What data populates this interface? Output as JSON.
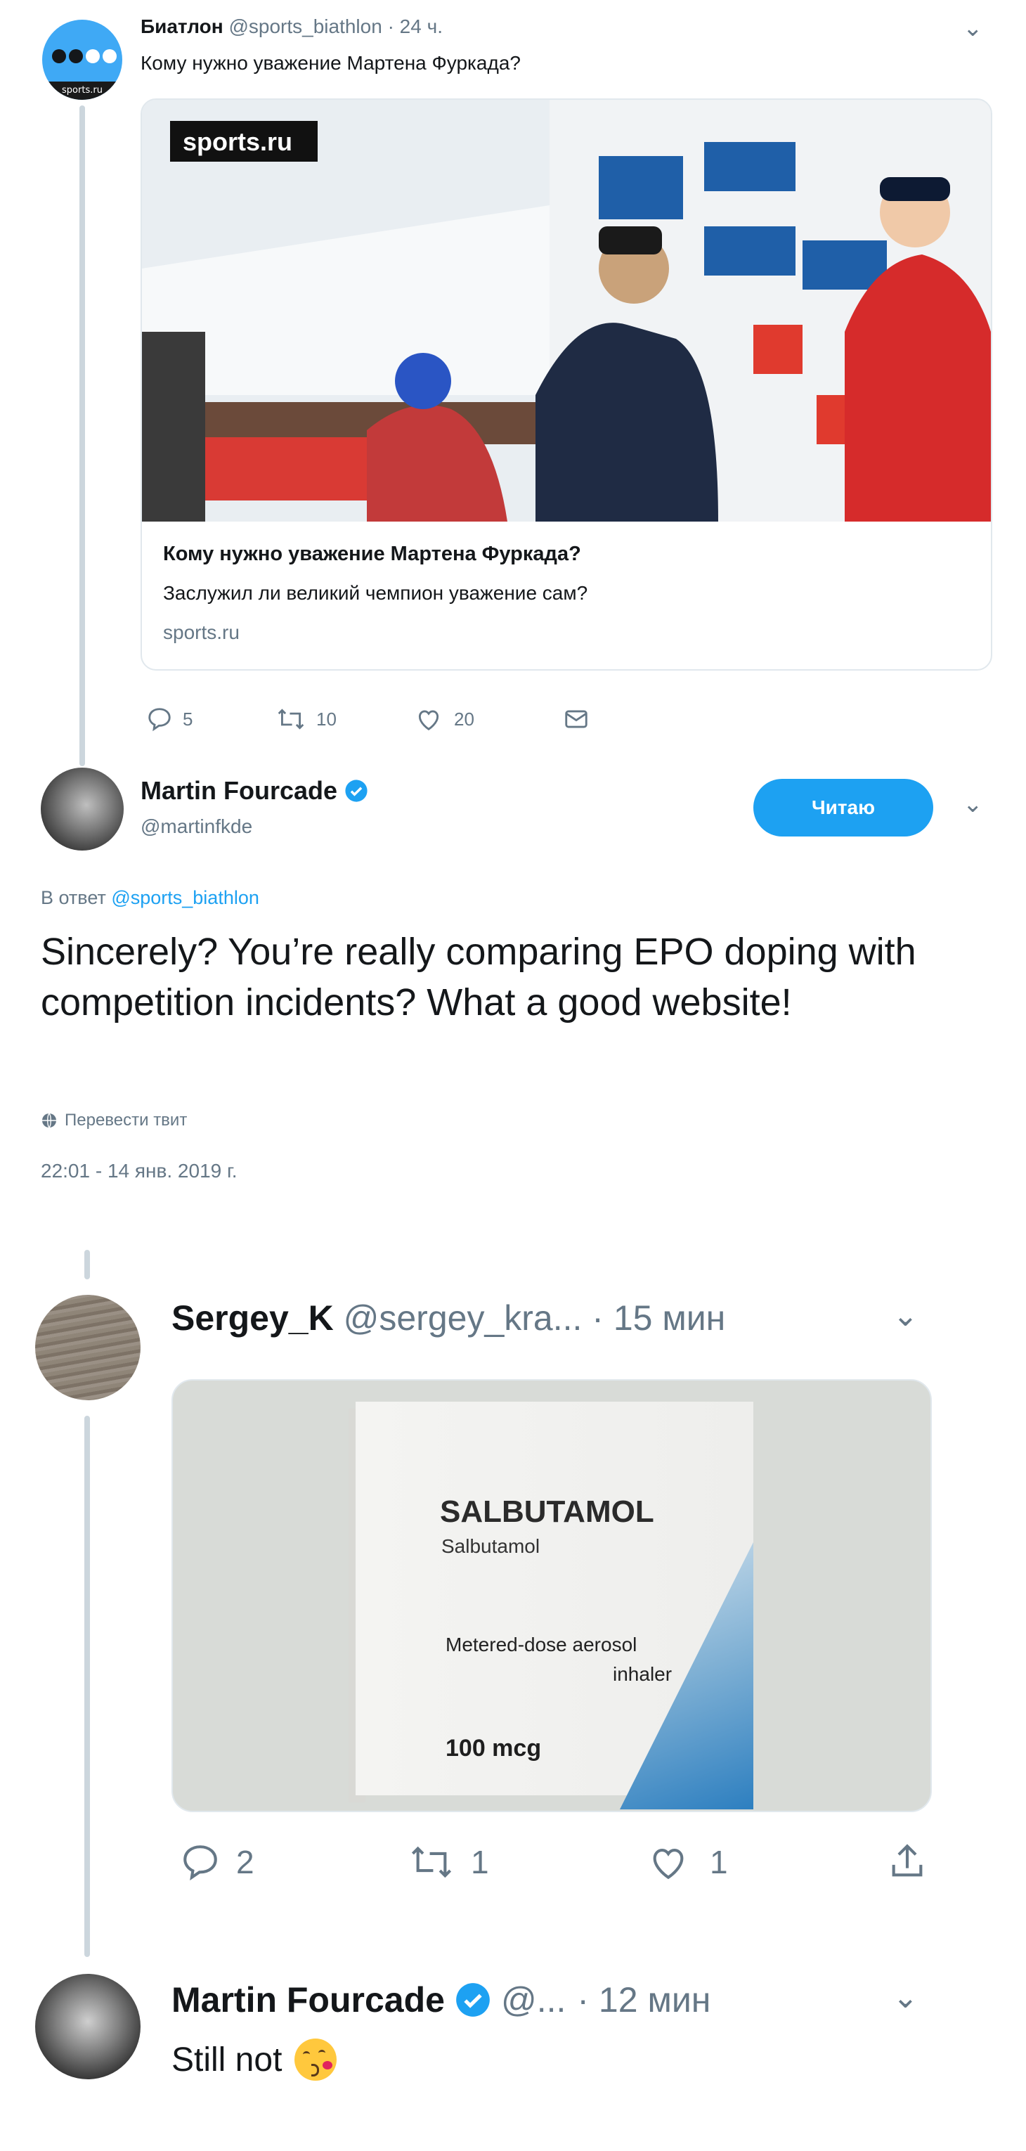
{
  "tweet1": {
    "author_name": "Биатлон",
    "handle": "@sports_biathlon",
    "time": "· 24 ч.",
    "text": "Кому нужно уважение Мартена Фуркада?",
    "avatar_text": "sports.ru",
    "card": {
      "logo": "sports.ru",
      "title": "Кому нужно уважение Мартена Фуркада?",
      "description": "Заслужил ли великий чемпион уважение сам?",
      "domain": "sports.ru"
    },
    "actions": {
      "replies": "5",
      "retweets": "10",
      "likes": "20"
    }
  },
  "tweet2": {
    "author_name": "Martin Fourcade",
    "handle": "@martinfkde",
    "follow_label": "Читаю",
    "reply_prefix": "В ответ",
    "reply_to": "@sports_biathlon",
    "text": "Sincerely? You’re really comparing EPO doping with competition incidents? What a good website!",
    "translate": "Перевести твит",
    "timestamp": "22:01 - 14 янв. 2019 г."
  },
  "tweet3": {
    "author_name": "Sergey_K",
    "handle": "@sergey_kra...",
    "time": "· 15 мин",
    "media": {
      "brand": "SALBUTAMOL",
      "subtitle": "Salbutamol",
      "form_line1": "Metered-dose aerosol",
      "form_line2": "inhaler",
      "dose": "100 mcg"
    },
    "actions": {
      "replies": "2",
      "retweets": "1",
      "likes": "1"
    }
  },
  "tweet4": {
    "author_name": "Martin Fourcade",
    "handle": "@...",
    "time": "· 12 мин",
    "text": "Still not",
    "emoji": "😘"
  },
  "colors": {
    "accent": "#1da1f2",
    "muted": "#657786",
    "line": "#ccd6dd"
  },
  "icons": [
    "reply-icon",
    "retweet-icon",
    "like-icon",
    "dm-icon",
    "share-icon",
    "verified-icon",
    "chevron-down-icon",
    "globe-icon"
  ]
}
